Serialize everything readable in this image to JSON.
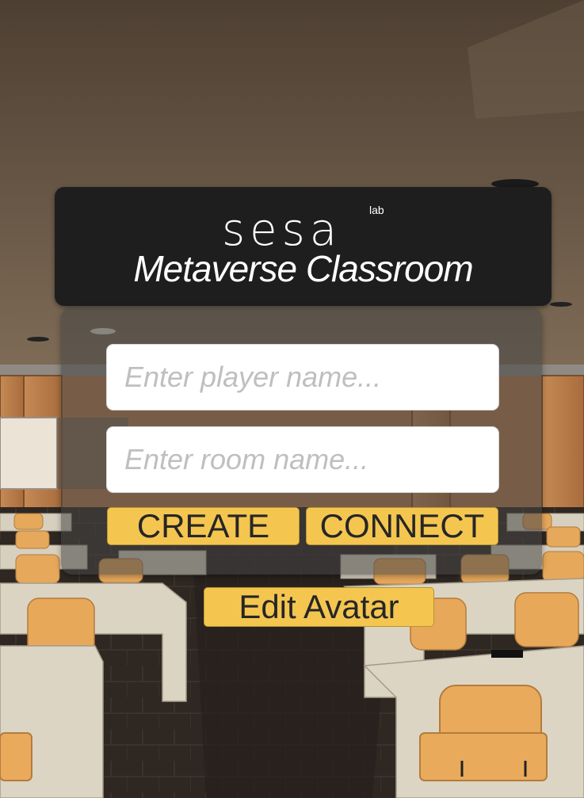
{
  "app": {
    "logo_text": "sesa",
    "logo_superscript": "lab",
    "title": "Metaverse Classroom"
  },
  "form": {
    "player_placeholder": "Enter player name...",
    "room_placeholder": "Enter room name..."
  },
  "buttons": {
    "create": "CREATE",
    "connect": "CONNECT",
    "edit_avatar": "Edit Avatar"
  },
  "colors": {
    "header_bg": "#1e1e1e",
    "button_bg": "#f4c650",
    "panel_bg": "rgba(70,70,70,0.55)"
  }
}
